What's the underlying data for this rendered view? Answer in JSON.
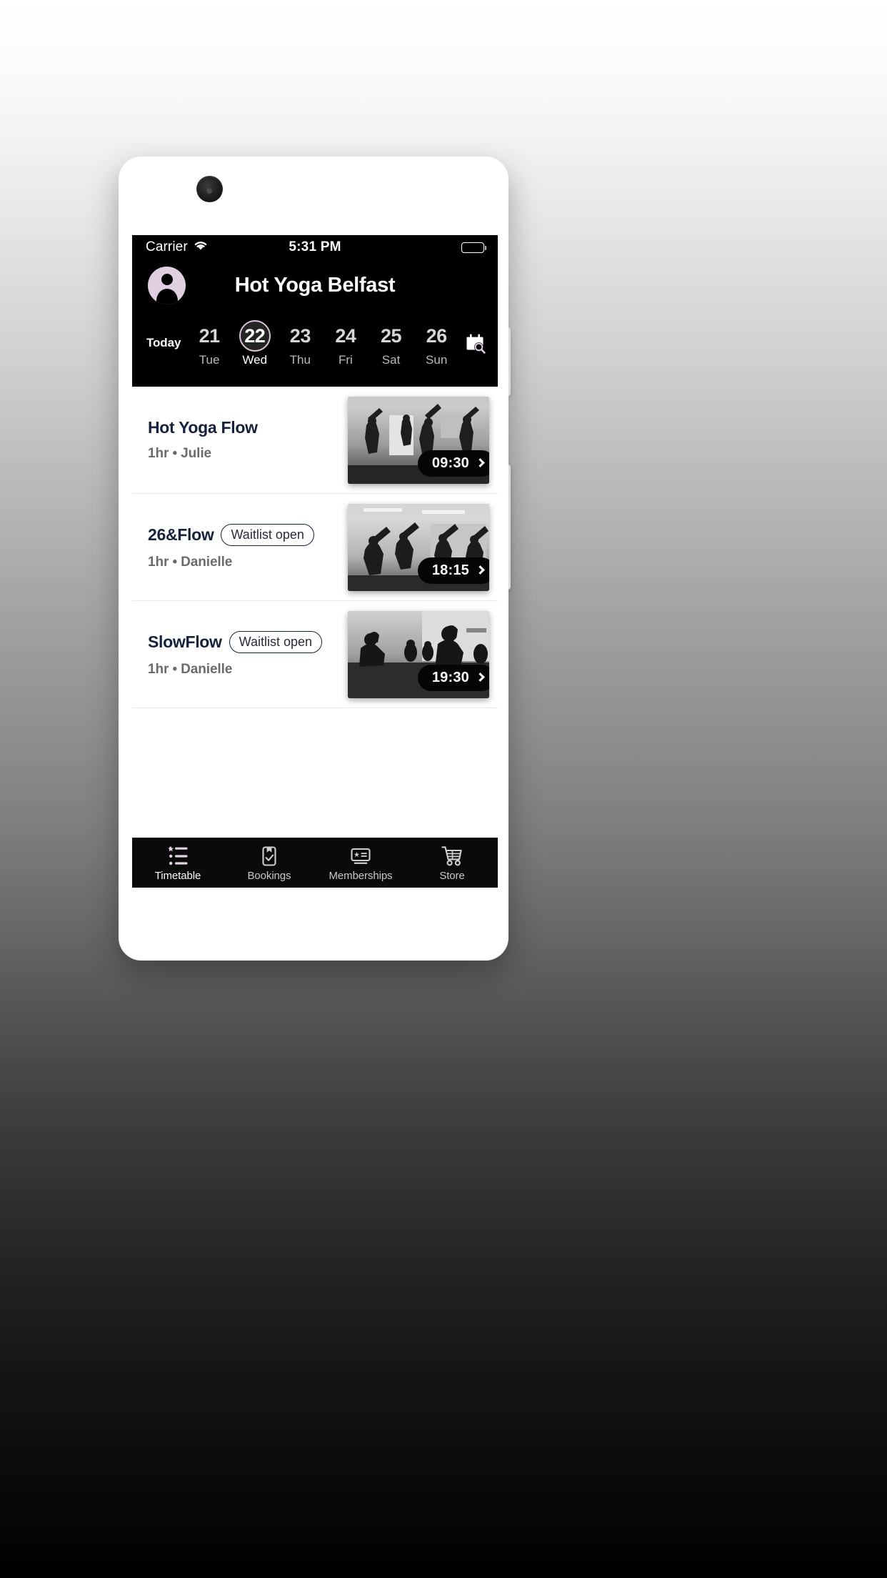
{
  "statusbar": {
    "carrier": "Carrier",
    "wifi_icon": "wifi-icon",
    "time": "5:31 PM",
    "battery_icon": "battery-full-icon"
  },
  "header": {
    "avatar_icon": "account-avatar",
    "title": "Hot Yoga Belfast",
    "accent_color": "#e0cfe0"
  },
  "daystrip": {
    "today_label": "Today",
    "calendar_search_icon": "calendar-search-icon",
    "days": [
      {
        "num": "21",
        "name": "Tue",
        "selected": false
      },
      {
        "num": "22",
        "name": "Wed",
        "selected": true
      },
      {
        "num": "23",
        "name": "Thu",
        "selected": false
      },
      {
        "num": "24",
        "name": "Fri",
        "selected": false
      },
      {
        "num": "25",
        "name": "Sat",
        "selected": false
      },
      {
        "num": "26",
        "name": "Sun",
        "selected": false
      }
    ]
  },
  "classes": [
    {
      "title": "Hot Yoga Flow",
      "badge": "",
      "meta": "1hr • Julie",
      "time": "09:30",
      "chevron_icon": "chevron-right-icon",
      "thumb_alt": "yoga-class-photo"
    },
    {
      "title": "26&Flow",
      "badge": "Waitlist open",
      "meta": "1hr • Danielle",
      "time": "18:15",
      "chevron_icon": "chevron-right-icon",
      "thumb_alt": "yoga-class-photo"
    },
    {
      "title": "SlowFlow",
      "badge": "Waitlist open",
      "meta": "1hr • Danielle",
      "time": "19:30",
      "chevron_icon": "chevron-right-icon",
      "thumb_alt": "yoga-class-photo"
    }
  ],
  "tabbar": [
    {
      "label": "Timetable",
      "icon": "timetable-list-icon",
      "active": true
    },
    {
      "label": "Bookings",
      "icon": "clipboard-check-icon",
      "active": false
    },
    {
      "label": "Memberships",
      "icon": "membership-card-icon",
      "active": false
    },
    {
      "label": "Store",
      "icon": "shopping-cart-icon",
      "active": false
    }
  ],
  "colors": {
    "header_bg": "#000000",
    "title_text": "#16213e",
    "meta_text": "#6b6b6b",
    "accent": "#e0cfe0"
  }
}
